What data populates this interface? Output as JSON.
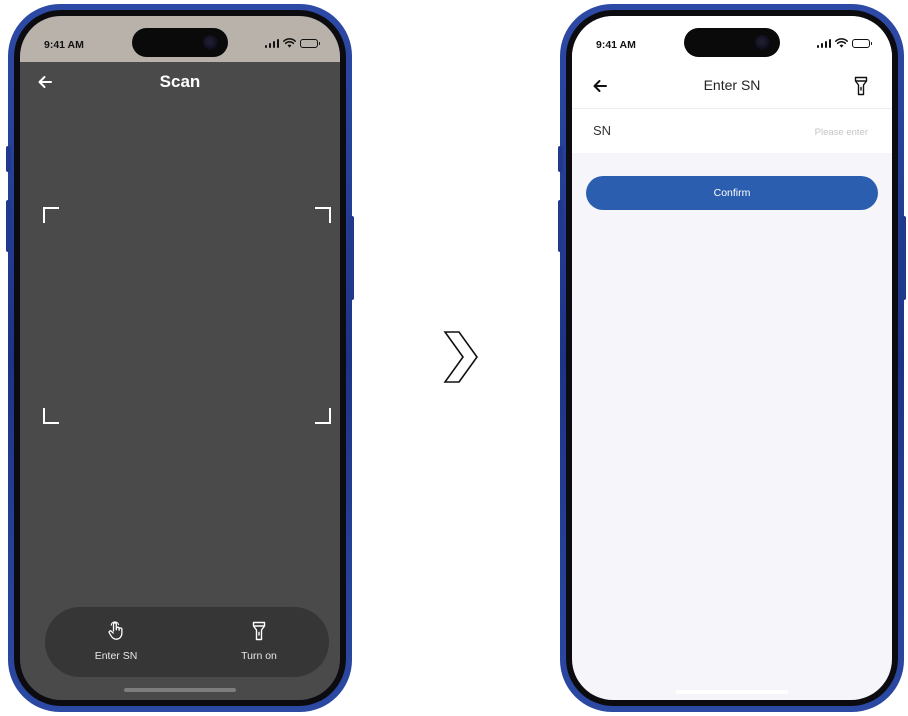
{
  "status_bar": {
    "time": "9:41 AM"
  },
  "scan_screen": {
    "title": "Scan",
    "actions": [
      {
        "label": "Enter SN",
        "icon": "tap-hand-icon"
      },
      {
        "label": "Turn on",
        "icon": "flashlight-icon"
      }
    ]
  },
  "enter_sn_screen": {
    "title": "Enter SN",
    "field_label": "SN",
    "field_placeholder": "Please enter",
    "field_value": "",
    "confirm_label": "Confirm"
  },
  "colors": {
    "phone_frame": "#1c3487",
    "scan_background": "#4a4a4a",
    "scan_statusbar": "#b8b2aa",
    "action_bar": "#363636",
    "confirm_button": "#2c5eaf",
    "enter_background": "#f6f6fa"
  },
  "icons": {
    "back": "back-arrow-icon",
    "torch": "flashlight-icon",
    "flow": "chevron-right-icon"
  }
}
